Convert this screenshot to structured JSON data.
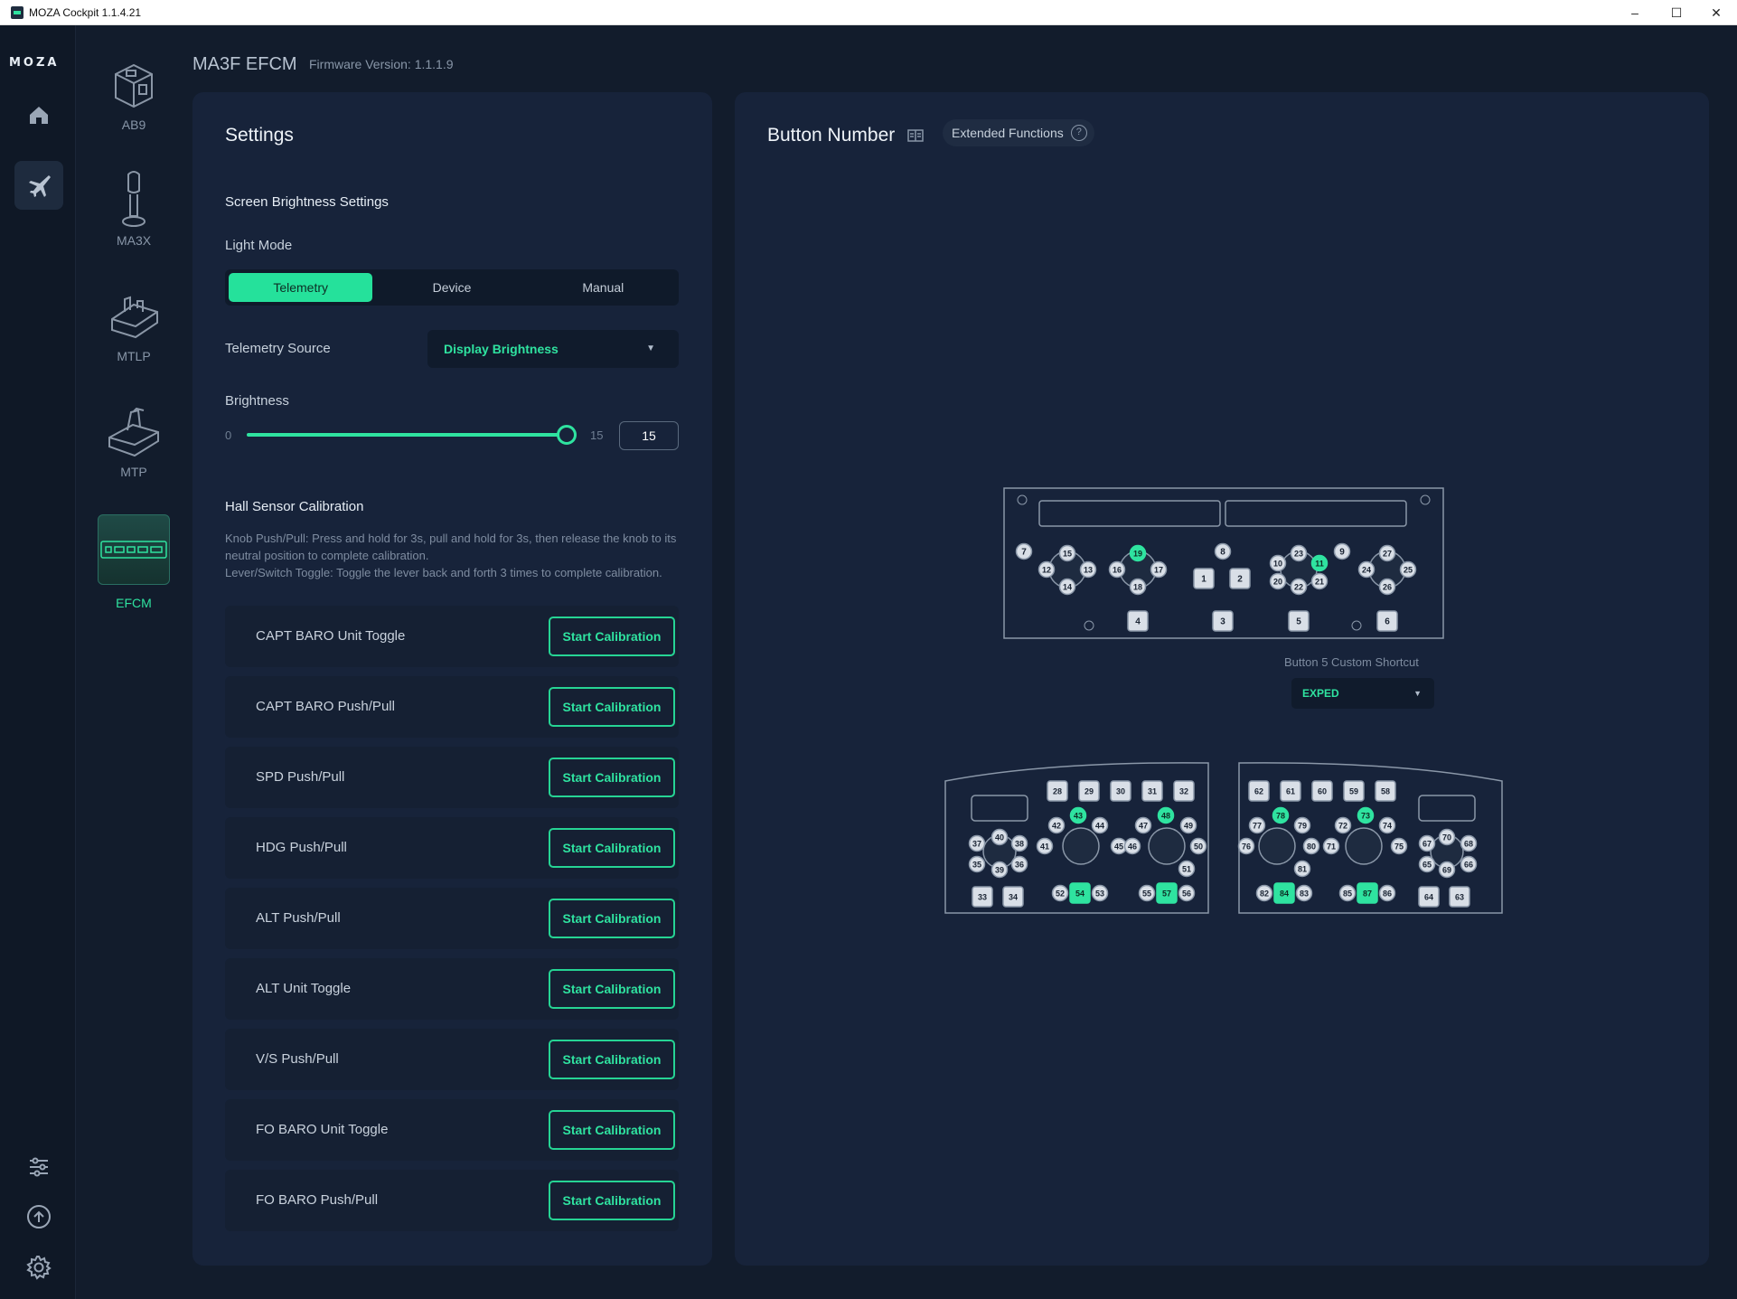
{
  "window": {
    "title": "MOZA Cockpit 1.1.4.21",
    "minimize": "–",
    "maximize": "☐",
    "close": "✕"
  },
  "rail": {
    "logo": "MOZA"
  },
  "devices": [
    {
      "label": "AB9",
      "icon": "throttle-box-icon"
    },
    {
      "label": "MA3X",
      "icon": "joystick-icon"
    },
    {
      "label": "MTLP",
      "icon": "lever-panel-icon"
    },
    {
      "label": "MTP",
      "icon": "throttle-quadrant-icon"
    },
    {
      "label": "EFCM",
      "icon": "efcm-panel-icon"
    }
  ],
  "header": {
    "title": "MA3F EFCM",
    "firmware": "Firmware Version: 1.1.1.9"
  },
  "settings": {
    "title": "Settings",
    "screen_brightness_title": "Screen Brightness Settings",
    "light_mode_label": "Light Mode",
    "light_modes": [
      "Telemetry",
      "Device",
      "Manual"
    ],
    "selected_light_mode": "Telemetry",
    "telemetry_source_label": "Telemetry Source",
    "telemetry_source_value": "Display Brightness",
    "brightness_label": "Brightness",
    "brightness_min": "0",
    "brightness_max": "15",
    "brightness_value": "15",
    "hall_title": "Hall Sensor Calibration",
    "hall_desc1": "Knob Push/Pull: Press and hold for 3s, pull and hold for 3s, then release the knob to its neutral position to complete calibration.",
    "hall_desc2": "Lever/Switch Toggle: Toggle the lever back and forth 3 times to complete calibration.",
    "calibration_button_label": "Start Calibration",
    "calibrations": [
      "CAPT BARO Unit Toggle",
      "CAPT BARO Push/Pull",
      "SPD Push/Pull",
      "HDG Push/Pull",
      "ALT Push/Pull",
      "ALT Unit Toggle",
      "V/S Push/Pull",
      "FO BARO Unit Toggle",
      "FO BARO Push/Pull"
    ]
  },
  "button_number": {
    "title": "Button Number",
    "extended_functions": "Extended Functions",
    "shortcut_label": "Button 5 Custom Shortcut",
    "shortcut_value": "EXPED",
    "highlighted_buttons": [
      "11",
      "19",
      "43",
      "48",
      "54",
      "57",
      "73",
      "78",
      "84",
      "87"
    ]
  },
  "colors": {
    "accent": "#2fe3a0",
    "panel": "#17233a",
    "background": "#121c2c"
  }
}
